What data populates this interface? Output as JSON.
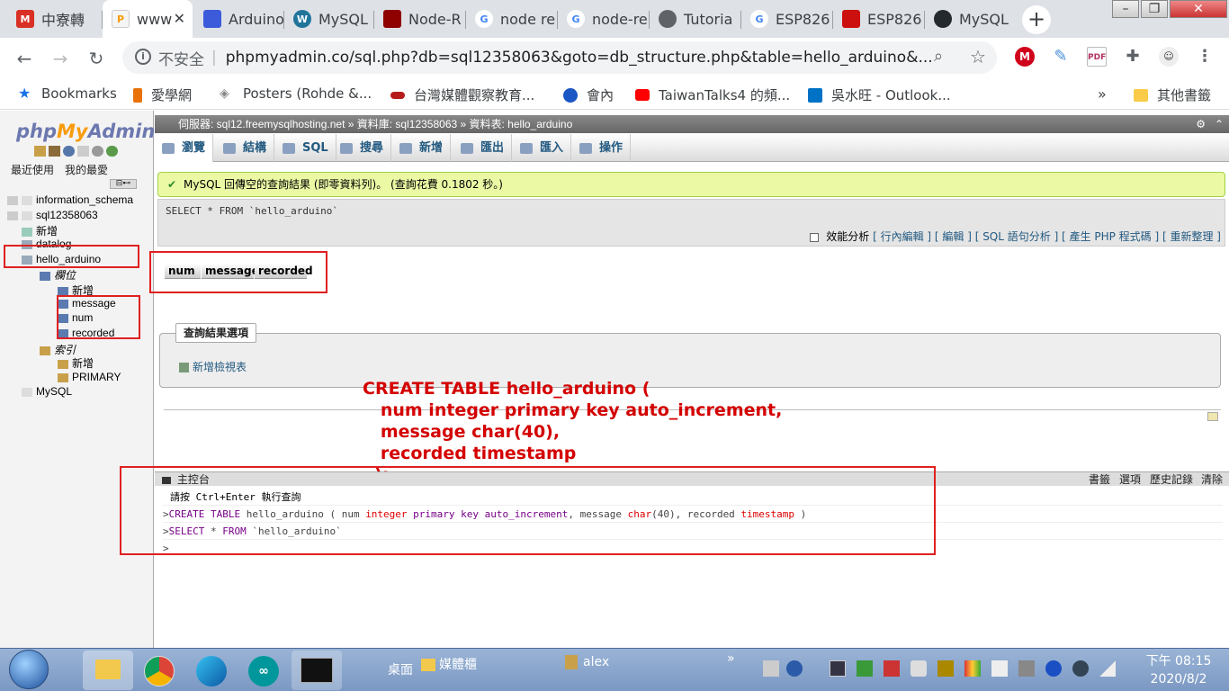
{
  "browser": {
    "tabs": [
      {
        "label": "中寮轉",
        "icon": "gmail-icon",
        "color": "#d93025"
      },
      {
        "label": "www",
        "icon": "phpmyadmin-icon",
        "color": "#f89c0e",
        "active": true
      },
      {
        "label": "Arduino",
        "icon": "book-icon",
        "color": "#3b5bdb"
      },
      {
        "label": "MySQL",
        "icon": "wordpress-icon",
        "color": "#21759b"
      },
      {
        "label": "Node-R",
        "icon": "nodered-icon",
        "color": "#8f0000"
      },
      {
        "label": "node re",
        "icon": "google-icon",
        "color": "#4285f4"
      },
      {
        "label": "node-re",
        "icon": "google-icon",
        "color": "#4285f4"
      },
      {
        "label": "Tutoria",
        "icon": "globe-icon",
        "color": "#5f6368"
      },
      {
        "label": "ESP826",
        "icon": "google-icon",
        "color": "#4285f4"
      },
      {
        "label": "ESP826",
        "icon": "ruby-icon",
        "color": "#cc1010"
      },
      {
        "label": "MySQL",
        "icon": "github-icon",
        "color": "#24292e"
      }
    ],
    "address": {
      "insecure_label": "不安全",
      "url": "phpmyadmin.co/sql.php?db=sql12358063&goto=db_structure.php&table=hello_arduino&..."
    },
    "bookmarks": [
      {
        "label": "Bookmarks",
        "icon": "star-icon",
        "color": "#1a73e8"
      },
      {
        "label": "愛學網",
        "icon": "torch-icon",
        "color": "#e8710a"
      },
      {
        "label": "Posters (Rohde &...",
        "icon": "diamond-icon",
        "color": "#888888"
      },
      {
        "label": "台灣媒體觀察教育...",
        "icon": "eye-icon",
        "color": "#b71c1c"
      },
      {
        "label": "會內",
        "icon": "windows-icon",
        "color": "#1a56c4"
      },
      {
        "label": "TaiwanTalks4 的頻...",
        "icon": "youtube-icon",
        "color": "#ff0000"
      },
      {
        "label": "吳水旺 - Outlook...",
        "icon": "outlook-icon",
        "color": "#0072c6"
      }
    ],
    "more_bookmarks": "其他書籤",
    "overflow": "»"
  },
  "pma": {
    "logo": {
      "php": "php",
      "my": "My",
      "admin": "Admin"
    },
    "left_links": [
      "最近使用",
      "我的最愛"
    ],
    "tree": [
      {
        "label": "information_schema",
        "depth": 0
      },
      {
        "label": "sql12358063",
        "depth": 0
      },
      {
        "label": "新增",
        "depth": 1
      },
      {
        "label": "datalog",
        "depth": 1
      },
      {
        "label": "hello_arduino",
        "depth": 1
      },
      {
        "label": "欄位",
        "depth": 2
      },
      {
        "label": "新增",
        "depth": 3
      },
      {
        "label": "message",
        "depth": 3
      },
      {
        "label": "num",
        "depth": 3
      },
      {
        "label": "recorded",
        "depth": 3
      },
      {
        "label": "索引",
        "depth": 2
      },
      {
        "label": "新增",
        "depth": 3
      },
      {
        "label": "PRIMARY",
        "depth": 3
      },
      {
        "label": "MySQL",
        "depth": 0
      }
    ],
    "breadcrumb": {
      "server": "伺服器: sql12.freemysqlhosting.net",
      "db": "資料庫: sql12358063",
      "table": "資料表: hello_arduino"
    },
    "tabs": [
      "瀏覽",
      "結構",
      "SQL",
      "搜尋",
      "新增",
      "匯出",
      "匯入",
      "操作"
    ],
    "success_message": "MySQL 回傳空的查詢結果 (即零資料列)。 (查詢花費 0.1802 秒。)",
    "query": "SELECT * FROM `hello_arduino`",
    "query_links": {
      "profiling": "效能分析",
      "links": "[ 行內編輯 ] [ 編輯 ] [ SQL 語句分析 ] [ 產生 PHP 程式碼 ] [ 重新整理 ]"
    },
    "columns": [
      "num",
      "message",
      "recorded"
    ],
    "result_options": {
      "legend": "查詢結果選項",
      "create_view": "新增檢視表"
    },
    "console": {
      "title": "主控台",
      "actions": [
        "書籤",
        "選項",
        "歷史記錄",
        "清除"
      ],
      "hint": "請按 Ctrl+Enter 執行查詢",
      "history": [
        ">CREATE TABLE hello_arduino ( num integer primary key auto_increment, message char(40), recorded timestamp )",
        ">SELECT * FROM `hello_arduino`"
      ],
      "prompt": ">"
    }
  },
  "annotation": "CREATE TABLE hello_arduino (\n   num integer primary key auto_increment,\n   message char(40),\n   recorded timestamp\n  );",
  "taskbar": {
    "toolbar_desktop": "桌面",
    "toolbar_media": "媒體櫃",
    "user": "alex",
    "overflow": "»",
    "time": "下午 08:15",
    "date": "2020/8/2"
  },
  "colors": {
    "annotation_red": "#d40000",
    "highlight_box": "#e02020",
    "pma_link": "#235a81",
    "success_bg": "#ebf8a4"
  }
}
